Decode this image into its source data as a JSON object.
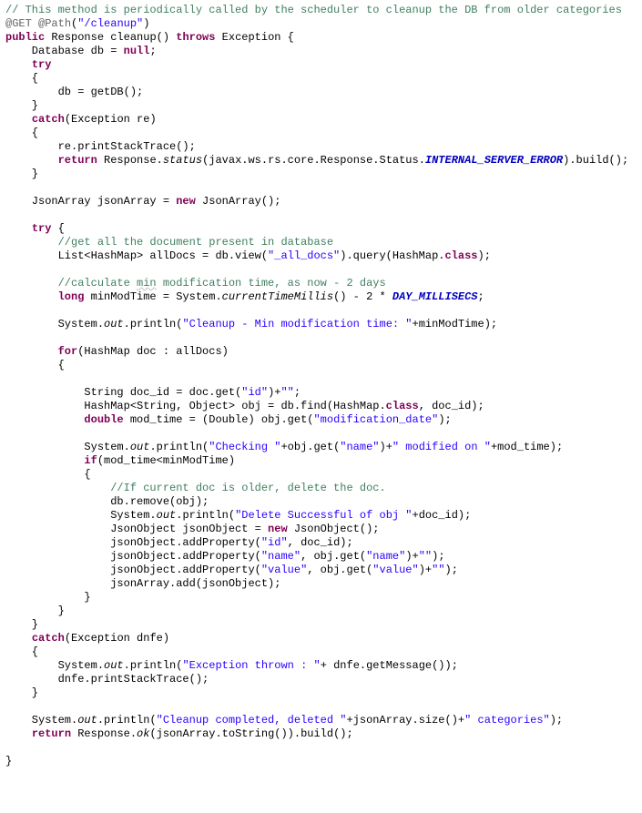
{
  "lines": [
    [
      {
        "cls": "c",
        "t": "// This method is periodically called by the scheduler to cleanup the DB from older categories"
      }
    ],
    [
      {
        "cls": "a",
        "t": "@GET"
      },
      {
        "t": " "
      },
      {
        "cls": "a",
        "t": "@Path"
      },
      {
        "t": "("
      },
      {
        "cls": "s",
        "t": "\"/cleanup\""
      },
      {
        "t": ")"
      }
    ],
    [
      {
        "cls": "k",
        "t": "public"
      },
      {
        "t": " Response cleanup() "
      },
      {
        "cls": "k",
        "t": "throws"
      },
      {
        "t": " Exception {"
      }
    ],
    [
      {
        "t": "    Database db = "
      },
      {
        "cls": "k",
        "t": "null"
      },
      {
        "t": ";"
      }
    ],
    [
      {
        "t": "    "
      },
      {
        "cls": "k",
        "t": "try"
      }
    ],
    [
      {
        "t": "    {"
      }
    ],
    [
      {
        "t": "        db = getDB();"
      }
    ],
    [
      {
        "t": "    }"
      }
    ],
    [
      {
        "t": "    "
      },
      {
        "cls": "k",
        "t": "catch"
      },
      {
        "t": "(Exception re)"
      }
    ],
    [
      {
        "t": "    {"
      }
    ],
    [
      {
        "t": "        re.printStackTrace();"
      }
    ],
    [
      {
        "t": "        "
      },
      {
        "cls": "k",
        "t": "return"
      },
      {
        "t": " Response."
      },
      {
        "cls": "m",
        "t": "status"
      },
      {
        "t": "(javax.ws.rs.core.Response.Status."
      },
      {
        "cls": "sc",
        "t": "INTERNAL_SERVER_ERROR"
      },
      {
        "t": ").build();"
      }
    ],
    [
      {
        "t": "    }"
      }
    ],
    [
      {
        "t": ""
      }
    ],
    [
      {
        "t": "    JsonArray jsonArray = "
      },
      {
        "cls": "k",
        "t": "new"
      },
      {
        "t": " JsonArray();"
      }
    ],
    [
      {
        "t": ""
      }
    ],
    [
      {
        "t": "    "
      },
      {
        "cls": "k",
        "t": "try"
      },
      {
        "t": " {"
      }
    ],
    [
      {
        "t": "        "
      },
      {
        "cls": "c",
        "t": "//get all the document present in database"
      }
    ],
    [
      {
        "t": "        List<HashMap> allDocs = db.view("
      },
      {
        "cls": "s",
        "t": "\"_all_docs\""
      },
      {
        "t": ").query(HashMap."
      },
      {
        "cls": "k",
        "t": "class"
      },
      {
        "t": ");"
      }
    ],
    [
      {
        "t": ""
      }
    ],
    [
      {
        "t": "        "
      },
      {
        "cls": "c",
        "t": "//calculate "
      },
      {
        "cls": "c u",
        "t": "min"
      },
      {
        "cls": "c",
        "t": " modification time, as now - 2 days"
      }
    ],
    [
      {
        "t": "        "
      },
      {
        "cls": "k",
        "t": "long"
      },
      {
        "t": " minModTime = System."
      },
      {
        "cls": "m",
        "t": "currentTimeMillis"
      },
      {
        "t": "() - 2 * "
      },
      {
        "cls": "sc",
        "t": "DAY_MILLISECS"
      },
      {
        "t": ";"
      }
    ],
    [
      {
        "t": ""
      }
    ],
    [
      {
        "t": "        System."
      },
      {
        "cls": "f",
        "t": "out"
      },
      {
        "t": ".println("
      },
      {
        "cls": "s",
        "t": "\"Cleanup - Min modification time: \""
      },
      {
        "t": "+minModTime);"
      }
    ],
    [
      {
        "t": ""
      }
    ],
    [
      {
        "t": "        "
      },
      {
        "cls": "k",
        "t": "for"
      },
      {
        "t": "(HashMap doc : allDocs)"
      }
    ],
    [
      {
        "t": "        {"
      }
    ],
    [
      {
        "t": ""
      }
    ],
    [
      {
        "t": "            String doc_id = doc.get("
      },
      {
        "cls": "s",
        "t": "\"id\""
      },
      {
        "t": ")+"
      },
      {
        "cls": "s",
        "t": "\"\""
      },
      {
        "t": ";"
      }
    ],
    [
      {
        "t": "            HashMap<String, Object> obj = db.find(HashMap."
      },
      {
        "cls": "k",
        "t": "class"
      },
      {
        "t": ", doc_id);"
      }
    ],
    [
      {
        "t": "            "
      },
      {
        "cls": "k",
        "t": "double"
      },
      {
        "t": " mod_time = (Double) obj.get("
      },
      {
        "cls": "s",
        "t": "\"modification_date\""
      },
      {
        "t": ");"
      }
    ],
    [
      {
        "t": ""
      }
    ],
    [
      {
        "t": "            System."
      },
      {
        "cls": "f",
        "t": "out"
      },
      {
        "t": ".println("
      },
      {
        "cls": "s",
        "t": "\"Checking \""
      },
      {
        "t": "+obj.get("
      },
      {
        "cls": "s",
        "t": "\"name\""
      },
      {
        "t": ")+"
      },
      {
        "cls": "s",
        "t": "\" modified on \""
      },
      {
        "t": "+mod_time);"
      }
    ],
    [
      {
        "t": "            "
      },
      {
        "cls": "k",
        "t": "if"
      },
      {
        "t": "(mod_time<minModTime)"
      }
    ],
    [
      {
        "t": "            {"
      }
    ],
    [
      {
        "t": "                "
      },
      {
        "cls": "c",
        "t": "//If current doc is older, delete the doc."
      }
    ],
    [
      {
        "t": "                db.remove(obj);"
      }
    ],
    [
      {
        "t": "                System."
      },
      {
        "cls": "f",
        "t": "out"
      },
      {
        "t": ".println("
      },
      {
        "cls": "s",
        "t": "\"Delete Successful of obj \""
      },
      {
        "t": "+doc_id);"
      }
    ],
    [
      {
        "t": "                JsonObject jsonObject = "
      },
      {
        "cls": "k",
        "t": "new"
      },
      {
        "t": " JsonObject();"
      }
    ],
    [
      {
        "t": "                jsonObject.addProperty("
      },
      {
        "cls": "s",
        "t": "\"id\""
      },
      {
        "t": ", doc_id);"
      }
    ],
    [
      {
        "t": "                jsonObject.addProperty("
      },
      {
        "cls": "s",
        "t": "\"name\""
      },
      {
        "t": ", obj.get("
      },
      {
        "cls": "s",
        "t": "\"name\""
      },
      {
        "t": ")+"
      },
      {
        "cls": "s",
        "t": "\"\""
      },
      {
        "t": ");"
      }
    ],
    [
      {
        "t": "                jsonObject.addProperty("
      },
      {
        "cls": "s",
        "t": "\"value\""
      },
      {
        "t": ", obj.get("
      },
      {
        "cls": "s",
        "t": "\"value\""
      },
      {
        "t": ")+"
      },
      {
        "cls": "s",
        "t": "\"\""
      },
      {
        "t": ");"
      }
    ],
    [
      {
        "t": "                jsonArray.add(jsonObject);"
      }
    ],
    [
      {
        "t": "            }"
      }
    ],
    [
      {
        "t": "        }"
      }
    ],
    [
      {
        "t": "    }"
      }
    ],
    [
      {
        "t": "    "
      },
      {
        "cls": "k",
        "t": "catch"
      },
      {
        "t": "(Exception dnfe)"
      }
    ],
    [
      {
        "t": "    {"
      }
    ],
    [
      {
        "t": "        System."
      },
      {
        "cls": "f",
        "t": "out"
      },
      {
        "t": ".println("
      },
      {
        "cls": "s",
        "t": "\"Exception thrown : \""
      },
      {
        "t": "+ dnfe.getMessage());"
      }
    ],
    [
      {
        "t": "        dnfe.printStackTrace();"
      }
    ],
    [
      {
        "t": "    }"
      }
    ],
    [
      {
        "t": ""
      }
    ],
    [
      {
        "t": "    System."
      },
      {
        "cls": "f",
        "t": "out"
      },
      {
        "t": ".println("
      },
      {
        "cls": "s",
        "t": "\"Cleanup completed, deleted \""
      },
      {
        "t": "+jsonArray.size()+"
      },
      {
        "cls": "s",
        "t": "\" categories\""
      },
      {
        "t": ");"
      }
    ],
    [
      {
        "t": "    "
      },
      {
        "cls": "k",
        "t": "return"
      },
      {
        "t": " Response."
      },
      {
        "cls": "m",
        "t": "ok"
      },
      {
        "t": "(jsonArray.toString()).build();"
      }
    ],
    [
      {
        "t": ""
      }
    ],
    [
      {
        "t": "}"
      }
    ]
  ]
}
